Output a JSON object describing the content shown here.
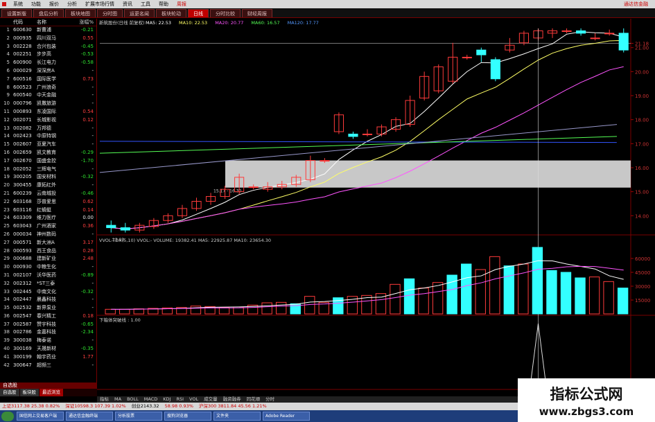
{
  "menu": {
    "items": [
      "系统",
      "功能",
      "报价",
      "分析",
      "扩展市场行情",
      "资讯",
      "工具",
      "帮助"
    ],
    "active": "周报",
    "brand": "通达信金融"
  },
  "tabs": [
    "设置新版",
    "盘后分析",
    "板块地图",
    "分时图",
    "运更名闻",
    "板块轮动",
    "日线",
    "分时比较",
    "财经周报"
  ],
  "active_tab": "日线",
  "list": {
    "headers": [
      "",
      "代码",
      "名称",
      "涨幅%"
    ],
    "rows": [
      {
        "i": "1",
        "code": "600630",
        "name": "新曹浦",
        "chg": "-0.21"
      },
      {
        "i": "2",
        "code": "000935",
        "name": "四川双马",
        "chg": "0.55"
      },
      {
        "i": "3",
        "code": "002228",
        "name": "合兴包装",
        "chg": "-0.45"
      },
      {
        "i": "4",
        "code": "002251",
        "name": "步步高",
        "chg": "-0.53"
      },
      {
        "i": "5",
        "code": "600900",
        "name": "长江电力",
        "chg": "-0.58"
      },
      {
        "i": "6",
        "code": "000029",
        "name": "深深房A",
        "chg": "-"
      },
      {
        "i": "7",
        "code": "600516",
        "name": "国际医学",
        "chg": "0.73"
      },
      {
        "i": "8",
        "code": "600523",
        "name": "广州浪奇",
        "chg": "-"
      },
      {
        "i": "9",
        "code": "600540",
        "name": "中天金融",
        "chg": "-"
      },
      {
        "i": "10",
        "code": "000796",
        "name": "凯撒旅游",
        "chg": "-"
      },
      {
        "i": "11",
        "code": "000893",
        "name": "东凌国际",
        "chg": "0.54"
      },
      {
        "i": "12",
        "code": "002071",
        "name": "长城影视",
        "chg": "0.12"
      },
      {
        "i": "13",
        "code": "002082",
        "name": "万邦德",
        "chg": "-"
      },
      {
        "i": "14",
        "code": "002423",
        "name": "中原特钢",
        "chg": "-"
      },
      {
        "i": "15",
        "code": "002607",
        "name": "亚夏汽车",
        "chg": "-"
      },
      {
        "i": "16",
        "code": "002659",
        "name": "凯文教育",
        "chg": "-0.29"
      },
      {
        "i": "17",
        "code": "002670",
        "name": "国盛金控",
        "chg": "-1.70"
      },
      {
        "i": "18",
        "code": "002052",
        "name": "三辉电气",
        "chg": "-"
      },
      {
        "i": "19",
        "code": "300205",
        "name": "国安材料",
        "chg": "-0.32"
      },
      {
        "i": "20",
        "code": "300455",
        "name": "康拓红外",
        "chg": "-"
      },
      {
        "i": "21",
        "code": "600239",
        "name": "云南城投",
        "chg": "-0.46"
      },
      {
        "i": "22",
        "code": "603168",
        "name": "莎普爱思",
        "chg": "0.62"
      },
      {
        "i": "23",
        "code": "603116",
        "name": "红蜻蜓",
        "chg": "0.14"
      },
      {
        "i": "24",
        "code": "603309",
        "name": "维力医疗",
        "chg": "0.00"
      },
      {
        "i": "25",
        "code": "603043",
        "name": "广州酒家",
        "chg": "0.36"
      },
      {
        "i": "26",
        "code": "000034",
        "name": "神州数码",
        "chg": "-"
      },
      {
        "i": "27",
        "code": "000571",
        "name": "新大洲A",
        "chg": "3.17"
      },
      {
        "i": "28",
        "code": "000593",
        "name": "西王食品",
        "chg": "0.28"
      },
      {
        "i": "29",
        "code": "000688",
        "name": "建新矿业",
        "chg": "2.48"
      },
      {
        "i": "30",
        "code": "000930",
        "name": "中粮生化",
        "chg": "-"
      },
      {
        "i": "31",
        "code": "002107",
        "name": "沃华医药",
        "chg": "-0.89"
      },
      {
        "i": "32",
        "code": "002312",
        "name": "*ST三泰",
        "chg": "-"
      },
      {
        "i": "33",
        "code": "002445",
        "name": "中南文化",
        "chg": "-0.32"
      },
      {
        "i": "34",
        "code": "002447",
        "name": "晨鑫科技",
        "chg": "-"
      },
      {
        "i": "35",
        "code": "002532",
        "name": "新界泵业",
        "chg": "-"
      },
      {
        "i": "36",
        "code": "002547",
        "name": "春兴精工",
        "chg": "0.18"
      },
      {
        "i": "37",
        "code": "002587",
        "name": "赞宇科技",
        "chg": "-0.65"
      },
      {
        "i": "38",
        "code": "002786",
        "name": "金嘉科技",
        "chg": "-2.34"
      },
      {
        "i": "39",
        "code": "300038",
        "name": "梅泰诺",
        "chg": "-"
      },
      {
        "i": "40",
        "code": "300169",
        "name": "天晟新材",
        "chg": "-0.35"
      },
      {
        "i": "41",
        "code": "300199",
        "name": "翰宇药业",
        "chg": "1.77"
      },
      {
        "i": "42",
        "code": "300647",
        "name": "超频三",
        "chg": "-"
      }
    ],
    "footer_title": "自选股",
    "footer_tabs": [
      "自选股",
      "板块股",
      "最近浏览"
    ]
  },
  "chart_data": [
    {
      "type": "candlestick",
      "title": "新筑股份(日线 前复权)",
      "legend": [
        "MA5: 22.53",
        "MA10: 22.53",
        "MA20: 20.77",
        "MA60: 16.57",
        "MA120: 17.77"
      ],
      "y_ticks": [
        "21.18",
        "21.00",
        "20.00",
        "19.00",
        "18.00",
        "17.00",
        "16.00",
        "15.00",
        "14.00"
      ],
      "ylim": [
        13.2,
        21.8
      ],
      "annotations": [
        "15.17 - 16.30",
        "13.03"
      ],
      "candles": [
        [
          13.6,
          13.5,
          13.8,
          13.3
        ],
        [
          13.5,
          13.4,
          13.7,
          13.3
        ],
        [
          13.4,
          13.6,
          13.7,
          13.3
        ],
        [
          13.55,
          13.8,
          13.9,
          13.45
        ],
        [
          13.8,
          14.0,
          14.1,
          13.7
        ],
        [
          14.0,
          14.3,
          14.45,
          13.9
        ],
        [
          14.3,
          14.6,
          14.75,
          14.2
        ],
        [
          14.6,
          14.8,
          14.95,
          14.45
        ],
        [
          14.8,
          15.1,
          15.25,
          14.7
        ],
        [
          15.0,
          15.6,
          15.75,
          14.9
        ],
        [
          15.2,
          15.2,
          15.3,
          15.1
        ],
        [
          15.1,
          15.2,
          15.4,
          15.0
        ],
        [
          15.2,
          15.3,
          15.45,
          15.1
        ],
        [
          15.3,
          15.6,
          15.7,
          15.2
        ],
        [
          15.5,
          16.3,
          16.5,
          15.4
        ],
        [
          16.3,
          16.3,
          16.4,
          16.2
        ],
        [
          17.5,
          18.2,
          18.3,
          17.4
        ],
        [
          17.4,
          17.3,
          17.5,
          17.2
        ],
        [
          17.4,
          17.4,
          17.6,
          17.3
        ],
        [
          17.4,
          17.7,
          17.8,
          17.3
        ],
        [
          17.6,
          18.0,
          18.1,
          17.5
        ],
        [
          17.8,
          18.8,
          19.0,
          17.7
        ],
        [
          18.9,
          19.8,
          20.0,
          18.8
        ],
        [
          19.2,
          20.2,
          20.3,
          19.1
        ],
        [
          19.6,
          20.6,
          21.2,
          19.5
        ],
        [
          20.6,
          20.6,
          20.7,
          20.5
        ],
        [
          20.9,
          20.7,
          21.0,
          20.4
        ],
        [
          20.5,
          19.7,
          20.6,
          19.6
        ],
        [
          20.9,
          21.1,
          21.4,
          20.8
        ],
        [
          21.2,
          21.6,
          21.7,
          21.1
        ],
        [
          21.4,
          21.7,
          21.8,
          21.3
        ],
        [
          21.6,
          21.7,
          21.8,
          21.4
        ],
        [
          21.7,
          21.7,
          21.8,
          21.6
        ],
        [
          21.7,
          21.6,
          21.8,
          21.5
        ],
        [
          21.4,
          21.4,
          21.6,
          21.3
        ],
        [
          21.6,
          21.6,
          21.75,
          21.5
        ],
        [
          21.6,
          20.9,
          21.8,
          20.8
        ]
      ]
    },
    {
      "type": "bar",
      "title": "VVOL-TDX(5,10)  VVOL:-  VOLUME: 19382.41  MA5: 22925.87  MA10: 23654.30",
      "y_ticks": [
        "60000",
        "45000",
        "30000",
        "15000"
      ],
      "ylim": [
        0,
        72000
      ],
      "values": [
        5000,
        5000,
        5500,
        6000,
        6500,
        7000,
        8500,
        8000,
        7000,
        7500,
        9500,
        12000,
        12500,
        11000,
        19000,
        12500,
        17500,
        19000,
        20000,
        22000,
        32000,
        38000,
        28000,
        34000,
        42000,
        54000,
        48000,
        62000,
        52000,
        54000,
        72000,
        47000,
        45000,
        39000,
        40000,
        35000,
        28000
      ],
      "highlighted": [
        13,
        16,
        21,
        24,
        25,
        28,
        30,
        31,
        32,
        33,
        36
      ]
    },
    {
      "type": "line",
      "title": "下箱体突破线 : 1.00"
    }
  ],
  "bottom_tabs": [
    "指标",
    "MA",
    "BOLL",
    "MACD",
    "KDJ",
    "RSI",
    "VOL",
    "成交量",
    "融资融券",
    "同花顺",
    "分时"
  ],
  "status": {
    "sh": "上证3117.38  25.38  0.82%",
    "sz": "深证10598.3  107.39  1.02%",
    "cy": "创业2143.32",
    "other": "58.98  0.93%",
    "extra": "沪深300  3811.84  45.56  1.21%"
  },
  "taskbar": [
    "国信网上交易客户端",
    "通达信金融终端",
    "分析股票",
    "搜狗浏览器",
    "文件夹",
    "Adobe Reader"
  ],
  "watermark": {
    "line1": "指标公式网",
    "line2": "www.zbgs3.com"
  }
}
